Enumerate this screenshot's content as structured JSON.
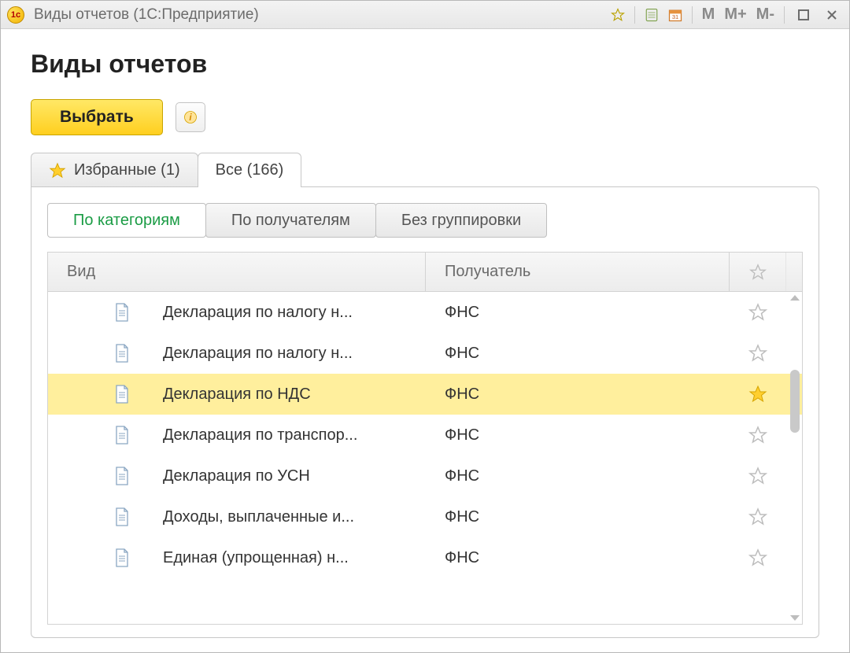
{
  "titlebar": {
    "app_icon_text": "1c",
    "title": "Виды отчетов  (1С:Предприятие)",
    "mem_buttons": [
      "M",
      "M+",
      "M-"
    ]
  },
  "page": {
    "title": "Виды отчетов"
  },
  "toolbar": {
    "select_label": "Выбрать"
  },
  "tabs": {
    "favorites_label": "Избранные (1)",
    "all_label": "Все (166)"
  },
  "grouping": {
    "by_category": "По категориям",
    "by_recipient": "По получателям",
    "no_grouping": "Без группировки"
  },
  "grid": {
    "header_vid": "Вид",
    "header_recv": "Получатель",
    "rows": [
      {
        "vid": "Декларация по налогу н...",
        "recv": "ФНС",
        "fav": false,
        "selected": false
      },
      {
        "vid": "Декларация по налогу н...",
        "recv": "ФНС",
        "fav": false,
        "selected": false
      },
      {
        "vid": "Декларация по НДС",
        "recv": "ФНС",
        "fav": true,
        "selected": true
      },
      {
        "vid": "Декларация по транспор...",
        "recv": "ФНС",
        "fav": false,
        "selected": false
      },
      {
        "vid": "Декларация по УСН",
        "recv": "ФНС",
        "fav": false,
        "selected": false
      },
      {
        "vid": "Доходы, выплаченные и...",
        "recv": "ФНС",
        "fav": false,
        "selected": false
      },
      {
        "vid": "Единая (упрощенная) н...",
        "recv": "ФНС",
        "fav": false,
        "selected": false
      }
    ]
  }
}
